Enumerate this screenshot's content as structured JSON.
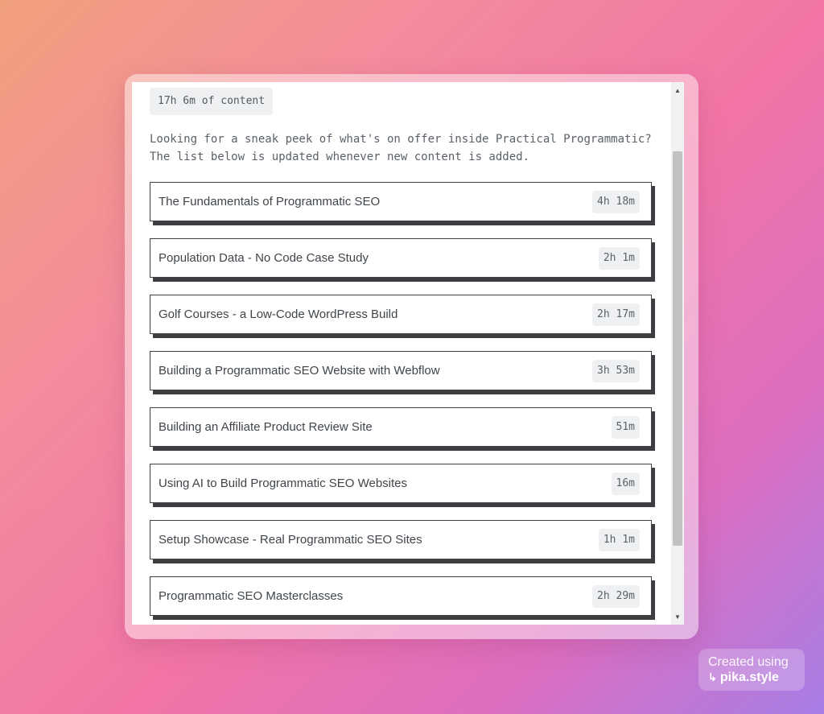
{
  "summary": {
    "total_content": "17h 6m of content",
    "intro": "Looking for a sneak peek of what's on offer inside Practical Programmatic? The list below is updated whenever new content is added."
  },
  "courses": [
    {
      "title": "The Fundamentals of Programmatic SEO",
      "duration": "4h 18m"
    },
    {
      "title": "Population Data - No Code Case Study",
      "duration": "2h 1m"
    },
    {
      "title": "Golf Courses - a Low-Code WordPress Build",
      "duration": "2h 17m"
    },
    {
      "title": "Building a Programmatic SEO Website with Webflow",
      "duration": "3h 53m"
    },
    {
      "title": "Building an Affiliate Product Review Site",
      "duration": "51m"
    },
    {
      "title": "Using AI to Build Programmatic SEO Websites",
      "duration": "16m"
    },
    {
      "title": "Setup Showcase - Real Programmatic SEO Sites",
      "duration": "1h 1m"
    },
    {
      "title": "Programmatic SEO Masterclasses",
      "duration": "2h 29m"
    }
  ],
  "scrollbar": {
    "up_icon": "triangle-up-icon",
    "down_icon": "triangle-down-icon"
  },
  "watermark": {
    "line1": "Created using",
    "line2": "pika.style",
    "icon": "return-arrow-icon"
  },
  "colors": {
    "card_border": "#3f4043",
    "badge_bg": "#eef0f2",
    "text": "#3f454b"
  }
}
